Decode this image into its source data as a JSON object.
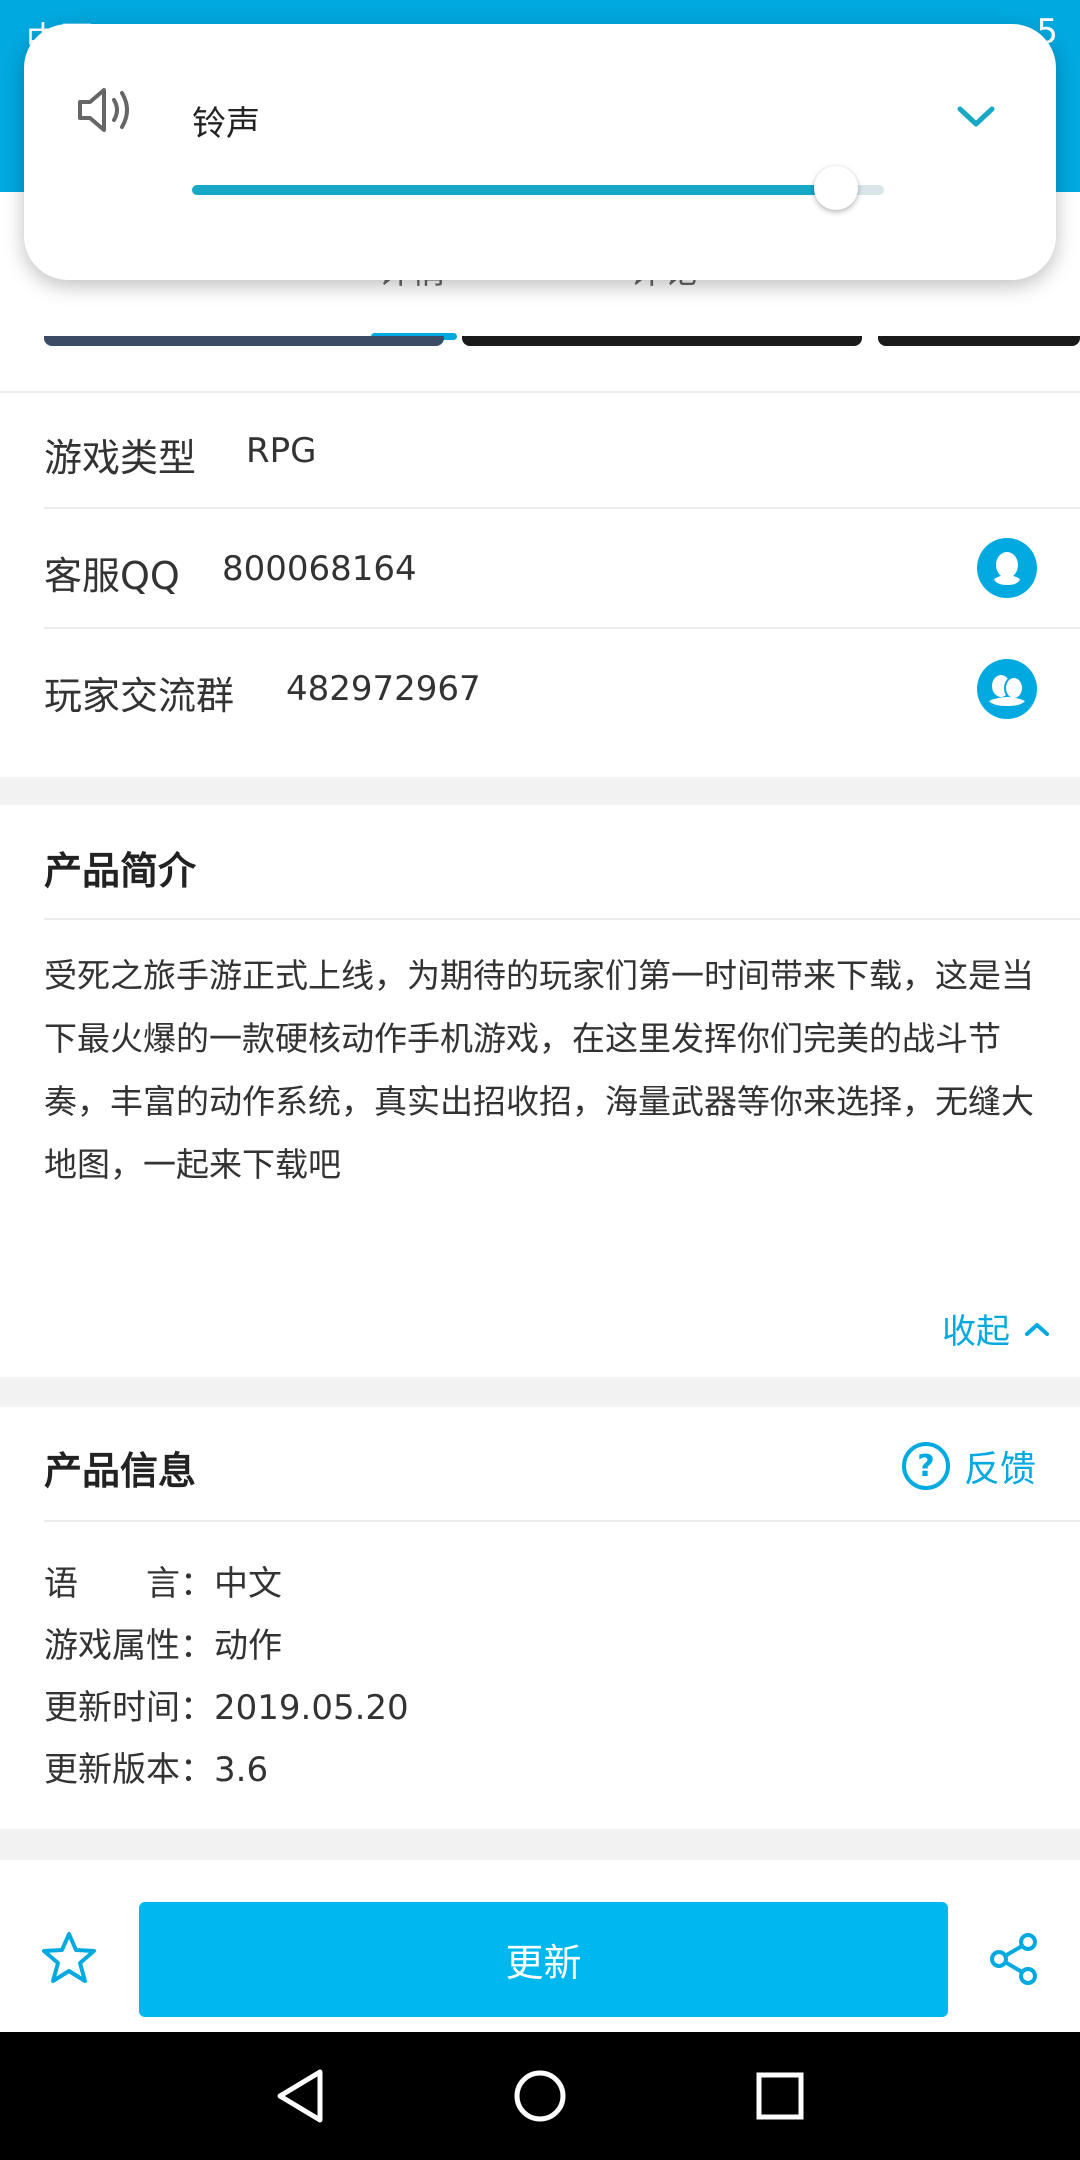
{
  "status_bar": {
    "left_text": "中国",
    "right_text": "5"
  },
  "tabs": [
    {
      "label": "详情"
    },
    {
      "label": "评论"
    }
  ],
  "info_rows": {
    "game_type": {
      "label": "游戏类型",
      "value": "RPG"
    },
    "service_qq": {
      "label": "客服QQ",
      "value": "800068164"
    },
    "player_group": {
      "label": "玩家交流群",
      "value": "482972967"
    }
  },
  "intro": {
    "title": "产品简介",
    "text": "受死之旅手游正式上线，为期待的玩家们第一时间带来下载，这是当下最火爆的一款硬核动作手机游戏，在这里发挥你们完美的战斗节奏，丰富的动作系统，真实出招收招，海量武器等你来选择，无缝大地图，一起来下载吧",
    "collapse_label": "收起"
  },
  "product_info": {
    "title": "产品信息",
    "feedback_label": "反馈",
    "lines": [
      {
        "label": "语　　言：",
        "value": "中文"
      },
      {
        "label": "游戏属性：",
        "value": "动作"
      },
      {
        "label": "更新时间：",
        "value": "2019.05.20"
      },
      {
        "label": "更新版本：",
        "value": "3.6"
      }
    ]
  },
  "bottom": {
    "update_label": "更新"
  },
  "volume_popup": {
    "title": "铃声",
    "level": 0.93
  },
  "colors": {
    "accent": "#00a9e0",
    "button": "#00b8ee",
    "slider": "#17a8c6"
  },
  "icons": {
    "speaker": "speaker-icon",
    "chevron": "chevron-down-icon",
    "qq": "qq-penguin-icon",
    "qq_group": "qq-group-icon",
    "star": "star-icon",
    "share": "share-icon",
    "back": "back-triangle-icon",
    "home": "home-circle-icon",
    "recents": "recents-square-icon"
  }
}
